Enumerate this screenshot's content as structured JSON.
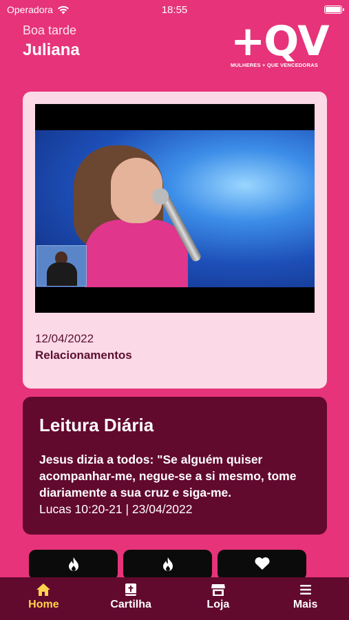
{
  "status_bar": {
    "carrier": "Operadora",
    "time": "18:55"
  },
  "greeting": {
    "salutation": "Boa tarde",
    "name": "Juliana"
  },
  "logo": {
    "mark": "+QV",
    "tagline": "MULHERES + QUE VENCEDORAS"
  },
  "video": {
    "date": "12/04/2022",
    "title": "Relacionamentos"
  },
  "daily_reading": {
    "title": "Leitura Diária",
    "text": "Jesus dizia a todos: \"Se alguém quiser acompanhar-me, negue-se a si mesmo, tome diariamente a sua cruz e siga-me.",
    "reference": "Lucas 10:20-21 | 23/04/2022"
  },
  "shortcuts": [
    {
      "icon": "flame-icon"
    },
    {
      "icon": "flame-icon"
    },
    {
      "icon": "heart-icon"
    }
  ],
  "tabbar": {
    "items": [
      {
        "label": "Home",
        "icon": "home-icon",
        "active": true
      },
      {
        "label": "Cartilha",
        "icon": "bible-icon",
        "active": false
      },
      {
        "label": "Loja",
        "icon": "store-icon",
        "active": false
      },
      {
        "label": "Mais",
        "icon": "menu-icon",
        "active": false
      }
    ]
  },
  "colors": {
    "background": "#e6337a",
    "dark": "#62092e",
    "card_light": "#fbd9e6",
    "active_tab": "#ffd34d"
  }
}
